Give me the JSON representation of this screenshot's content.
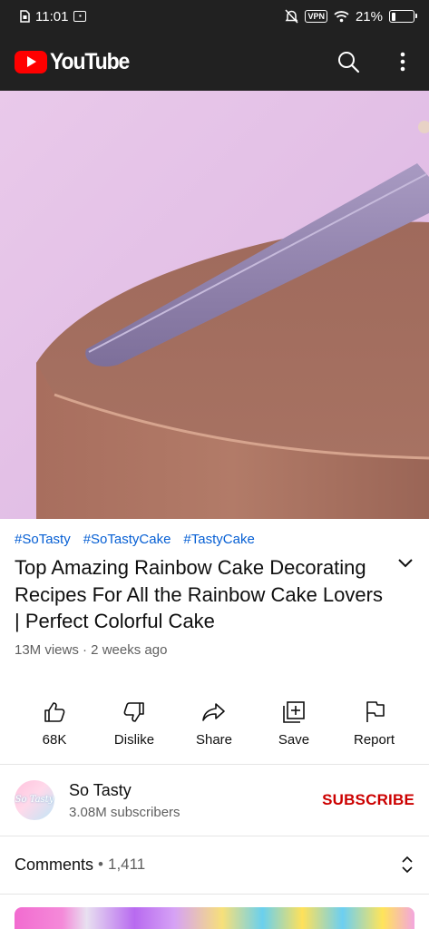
{
  "status_bar": {
    "time": "11:01",
    "vpn": "VPN",
    "battery": "21%",
    "battery_level": 0.21
  },
  "header": {
    "logo_text": "YouTube",
    "icons": [
      "search-icon",
      "more-vert-icon"
    ]
  },
  "video": {
    "hashtags": [
      "#SoTasty",
      "#SoTastyCake",
      "#TastyCake"
    ],
    "title": "Top Amazing Rainbow Cake Decorating Recipes For All the Rainbow Cake Lovers | Perfect Colorful Cake",
    "meta": "13M views · 2 weeks ago"
  },
  "actions": [
    {
      "label": "68K",
      "icon": "like-icon"
    },
    {
      "label": "Dislike",
      "icon": "dislike-icon"
    },
    {
      "label": "Share",
      "icon": "share-icon"
    },
    {
      "label": "Save",
      "icon": "save-icon"
    },
    {
      "label": "Report",
      "icon": "flag-icon"
    }
  ],
  "channel": {
    "name": "So Tasty",
    "subscribers": "3.08M subscribers",
    "subscribe_label": "SUBSCRIBE",
    "avatar_text": "So Tasty"
  },
  "comments": {
    "label": "Comments",
    "separator": "•",
    "count": "1,411"
  },
  "colors": {
    "header_bg": "#212121",
    "brand_red": "#ff0000",
    "subscribe_red": "#cc0000",
    "hashtag_blue": "#065fd4"
  }
}
